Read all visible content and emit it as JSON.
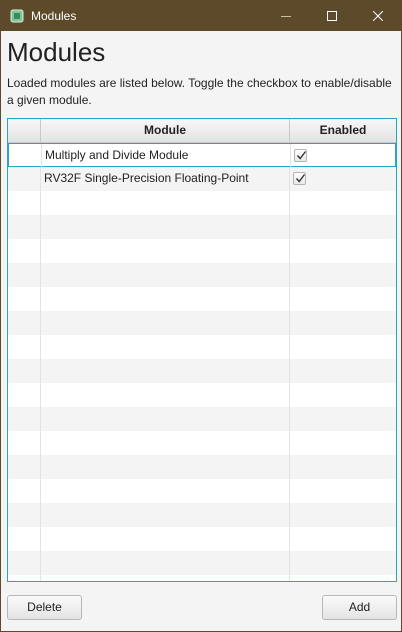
{
  "window": {
    "title": "Modules",
    "title_bar_color": "#5c4a2a",
    "accent": "#2aa3c9",
    "app_icon": "chip-icon",
    "controls": [
      "minimize-icon",
      "maximize-icon",
      "close-icon"
    ]
  },
  "heading": "Modules",
  "description": "Loaded modules are listed below. Toggle the checkbox to enable/disable a given module.",
  "table": {
    "columns": [
      "",
      "Module",
      "Enabled"
    ],
    "rows": [
      {
        "module": "Multiply and Divide Module",
        "enabled": true,
        "selected": true
      },
      {
        "module": "RV32F Single-Precision Floating-Point",
        "enabled": true,
        "selected": false
      }
    ]
  },
  "buttons": {
    "delete": "Delete",
    "add": "Add"
  }
}
